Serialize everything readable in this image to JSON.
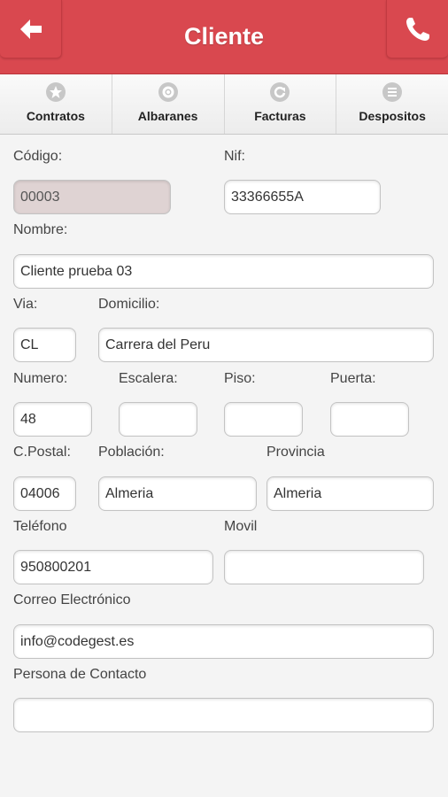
{
  "header": {
    "title": "Cliente",
    "back_icon": "arrow-left-icon",
    "call_icon": "phone-icon",
    "color": "#d9484f"
  },
  "nav": [
    {
      "label": "Contratos",
      "icon": "star-icon"
    },
    {
      "label": "Albaranes",
      "icon": "gear-icon"
    },
    {
      "label": "Facturas",
      "icon": "refresh-icon"
    },
    {
      "label": "Despositos",
      "icon": "list-icon"
    }
  ],
  "form": {
    "codigo": {
      "label": "Código:",
      "value": "00003"
    },
    "nif": {
      "label": "Nif:",
      "value": "33366655A"
    },
    "nombre": {
      "label": "Nombre:",
      "value": "Cliente prueba 03"
    },
    "via": {
      "label": "Via:",
      "value": "CL"
    },
    "domicilio": {
      "label": "Domicilio:",
      "value": "Carrera del Peru"
    },
    "numero": {
      "label": "Numero:",
      "value": "48"
    },
    "escalera": {
      "label": "Escalera:",
      "value": ""
    },
    "piso": {
      "label": "Piso:",
      "value": ""
    },
    "puerta": {
      "label": "Puerta:",
      "value": ""
    },
    "cpostal": {
      "label": "C.Postal:",
      "value": "04006"
    },
    "poblacion": {
      "label": "Población:",
      "value": "Almeria"
    },
    "provincia": {
      "label": "Provincia",
      "value": "Almeria"
    },
    "telefono": {
      "label": "Teléfono",
      "value": "950800201"
    },
    "movil": {
      "label": "Movil",
      "value": ""
    },
    "correo": {
      "label": "Correo Electrónico",
      "value": "info@codegest.es"
    },
    "contacto": {
      "label": "Persona de Contacto",
      "value": ""
    }
  }
}
